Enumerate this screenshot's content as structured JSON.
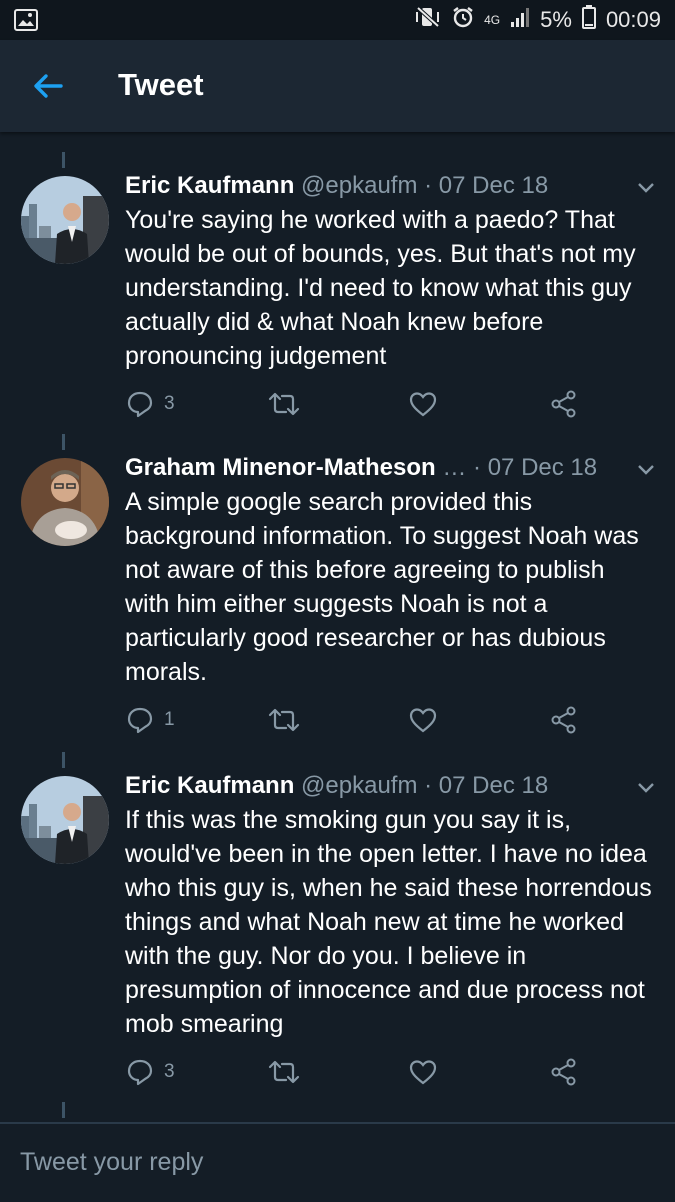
{
  "status_bar": {
    "battery": "5%",
    "time": "00:09",
    "network": "4G"
  },
  "header": {
    "title": "Tweet"
  },
  "tweets": [
    {
      "name": "Eric Kaufmann",
      "handle": "@epkaufm",
      "date": "· 07 Dec 18",
      "text": "You're saying he worked with a paedo? That would be out of bounds, yes. But that's not my understanding. I'd need to know what this guy actually did & what Noah knew before pronouncing judgement",
      "reply_count": "3",
      "retweet_count": "",
      "like_count": ""
    },
    {
      "name": "Graham Minenor-Matheson",
      "handle": "…",
      "date": "· 07 Dec 18",
      "text": "A simple google search provided this background information.  To suggest Noah was not aware of this before agreeing to publish with him either suggests Noah is not a particularly good researcher or has dubious morals.",
      "reply_count": "1",
      "retweet_count": "",
      "like_count": ""
    },
    {
      "name": "Eric Kaufmann",
      "handle": "@epkaufm",
      "date": "· 07 Dec 18",
      "text": "If this was the smoking gun you say it is, would've been in the open letter. I have no idea who this guy is, when he said these horrendous things and what Noah new at time he worked with the guy. Nor do you. I believe in presumption of innocence and due process not mob smearing",
      "reply_count": "3",
      "retweet_count": "",
      "like_count": ""
    }
  ],
  "reply": {
    "placeholder": "Tweet your reply"
  },
  "colors": {
    "background": "#141d26",
    "header": "#1c2733",
    "accent": "#1da1f2",
    "muted": "#8899a6"
  }
}
